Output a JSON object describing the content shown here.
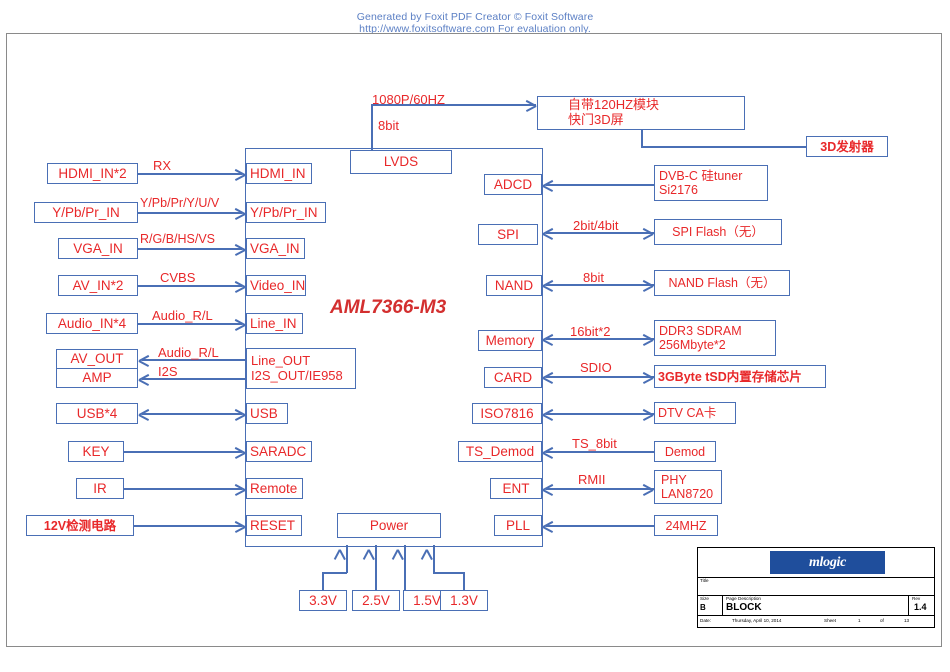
{
  "watermark": {
    "line1": "Generated by Foxit PDF Creator © Foxit Software",
    "line2": "http://www.foxitsoftware.com   For evaluation only."
  },
  "chip": {
    "label": "AML7366-M3"
  },
  "left_column": [
    {
      "name": "hdmi-in",
      "label": "HDMI_IN*2",
      "signal": "RX",
      "port": "HDMI_IN"
    },
    {
      "name": "ypbpr-in",
      "label": "Y/Pb/Pr_IN",
      "signal": "Y/Pb/Pr/Y/U/V",
      "port": "Y/Pb/Pr_IN"
    },
    {
      "name": "vga-in",
      "label": "VGA_IN",
      "signal": "R/G/B/HS/VS",
      "port": "VGA_IN"
    },
    {
      "name": "av-in",
      "label": "AV_IN*2",
      "signal": "CVBS",
      "port": "Video_IN"
    },
    {
      "name": "audio-in",
      "label": "Audio_IN*4",
      "signal": "Audio_R/L",
      "port": "Line_IN"
    },
    {
      "name": "av-out",
      "label": "AV_OUT",
      "signal": "Audio_R/L",
      "port": "Line_OUT"
    },
    {
      "name": "amp",
      "label": "AMP",
      "signal": "I2S",
      "port": "I2S_OUT/IE958"
    },
    {
      "name": "usb",
      "label": "USB*4",
      "signal": "",
      "port": "USB"
    },
    {
      "name": "key",
      "label": "KEY",
      "signal": "",
      "port": "SARADC"
    },
    {
      "name": "ir",
      "label": "IR",
      "signal": "",
      "port": "Remote"
    },
    {
      "name": "v12-detect",
      "label": "12V检测电路",
      "signal": "",
      "port": "RESET"
    }
  ],
  "right_column": [
    {
      "name": "tuner",
      "port": "ADCD",
      "signal": "",
      "label": "DVB-C 硅tuner\nSi2176"
    },
    {
      "name": "spi-flash",
      "port": "SPI",
      "signal": "2bit/4bit",
      "label": "SPI Flash（无）"
    },
    {
      "name": "nand-flash",
      "port": "NAND",
      "signal": "8bit",
      "label": "NAND Flash（无）"
    },
    {
      "name": "ddr",
      "port": "Memory",
      "signal": "16bit*2",
      "label": "DDR3 SDRAM\n256Mbyte*2"
    },
    {
      "name": "tsd",
      "port": "CARD",
      "signal": "SDIO",
      "label": "3GByte tSD内置存储芯片"
    },
    {
      "name": "ca-card",
      "port": "ISO7816",
      "signal": "",
      "label": "DTV CA卡"
    },
    {
      "name": "demod",
      "port": "TS_Demod",
      "signal": "TS_8bit",
      "label": "Demod"
    },
    {
      "name": "phy",
      "port": "ENT",
      "signal": "RMII",
      "label": "PHY\nLAN8720"
    },
    {
      "name": "osc",
      "port": "PLL",
      "signal": "",
      "label": "24MHZ"
    }
  ],
  "display_path": {
    "lvds_port": "LVDS",
    "signal_line1": "1080P/60HZ",
    "signal_line2": "8bit",
    "panel_line1": "自带120HZ模块",
    "panel_line2": "快门3D屏",
    "emitter": "3D发射器"
  },
  "power": {
    "block": "Power",
    "rails": [
      "3.3V",
      "2.5V",
      "1.5V",
      "1.3V"
    ]
  },
  "title_block": {
    "logo_text": "mlogic",
    "title_caption": "Title",
    "title_value": "",
    "size_caption": "Size",
    "size_value": "B",
    "desc_caption": "Page Description",
    "desc_value": "BLOCK",
    "rev_caption": "Rev",
    "rev_value": "1.4",
    "date_caption": "Date:",
    "date_value": "Thursday, April 10, 2014",
    "sheet_caption": "Sheet",
    "sheet_value": "1",
    "of_caption": "of",
    "of_value": "13"
  },
  "colors": {
    "text_red": "#e8282a",
    "border_blue": "#4a6fb5",
    "logo_blue": "#1f4e9c",
    "watermark_blue": "#5b7fc4"
  }
}
